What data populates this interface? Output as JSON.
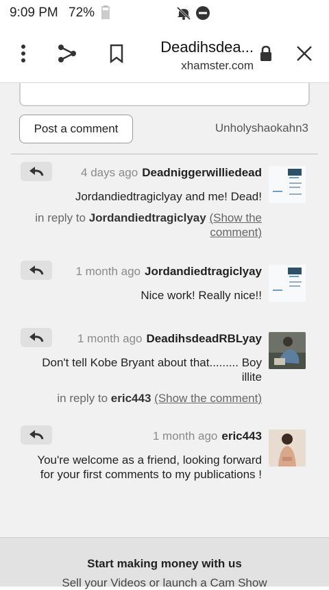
{
  "status": {
    "time": "9:09 PM",
    "battery": "72%",
    "icons": [
      "battery-icon",
      "mute-icon",
      "dnd-icon"
    ]
  },
  "toolbar": {
    "title": "Deadihsdea...",
    "domain": "xhamster.com",
    "icons": [
      "close-icon",
      "lock-icon",
      "bookmark-icon",
      "share-icon",
      "overflow-menu-icon"
    ]
  },
  "composer": {
    "username": "Unholyshaokahn3",
    "post_label": "Post a comment"
  },
  "comments": [
    {
      "author": "Deadniggerwilliedead",
      "time": "4 days ago",
      "text": "Jordandiedtragiclyay and me! Dead!",
      "reply_prefix": "in reply to",
      "reply_to": "Jordandiedtragiclyay",
      "show_link": "(Show the comment)"
    },
    {
      "author": "Jordandiedtragiclyay",
      "time": "1 month ago",
      "text": "Nice work! Really nice!!"
    },
    {
      "author": "DeadihsdeadRBLyay",
      "time": "1 month ago",
      "text": "Don't tell Kobe Bryant about that......... Boy illite",
      "reply_prefix": "in reply to",
      "reply_to": "eric443",
      "show_link": "(Show the comment)"
    },
    {
      "author": "eric443",
      "time": "1 month ago",
      "text": "You're welcome as a friend, looking forward for your first comments to my publications !"
    }
  ],
  "footer": {
    "title": "Start making money with us",
    "subtitle": "Sell your Videos or launch a Cam Show"
  },
  "colors": {
    "background": "#f1f1f1",
    "toolbar": "#ffffff",
    "reply_button": "#e0e0e0",
    "footer": "#e2e2e2"
  }
}
